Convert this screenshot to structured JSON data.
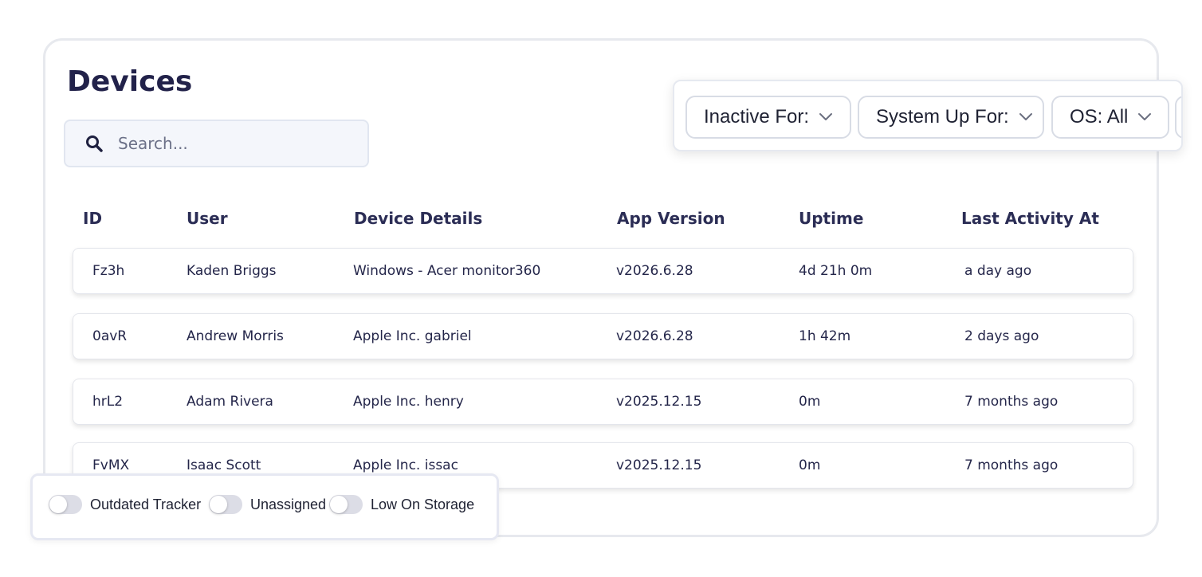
{
  "page": {
    "title": "Devices"
  },
  "search": {
    "placeholder": "Search...",
    "value": ""
  },
  "filters": [
    {
      "label": "Inactive For:",
      "icon": "chevron-down-icon"
    },
    {
      "label": "System Up For:",
      "icon": "chevron-down-icon"
    },
    {
      "label": "OS: All",
      "icon": "chevron-down-icon"
    }
  ],
  "table": {
    "headers": [
      "ID",
      "User",
      "Device Details",
      "App Version",
      "Uptime",
      "Last Activity At"
    ],
    "rows": [
      [
        "Fz3h",
        "Kaden Briggs",
        "Windows - Acer monitor360",
        "v2026.6.28",
        "4d 21h 0m",
        "a day ago"
      ],
      [
        "0avR",
        "Andrew Morris",
        "Apple Inc. gabriel",
        "v2026.6.28",
        "1h 42m",
        "2 days ago"
      ],
      [
        "hrL2",
        "Adam Rivera",
        "Apple Inc. henry",
        "v2025.12.15",
        "0m",
        "7 months ago"
      ],
      [
        "FvMX",
        "Isaac Scott",
        "Apple Inc. issac",
        "v2025.12.15",
        "0m",
        "7 months ago"
      ]
    ]
  },
  "toggles": [
    {
      "label": "Outdated Tracker",
      "on": false
    },
    {
      "label": "Unassigned",
      "on": false
    },
    {
      "label": "Low On Storage",
      "on": false
    }
  ],
  "colors": {
    "title": "#22224a",
    "search_bg": "#f4f6fb",
    "toggle_off": "#dcdde6"
  }
}
